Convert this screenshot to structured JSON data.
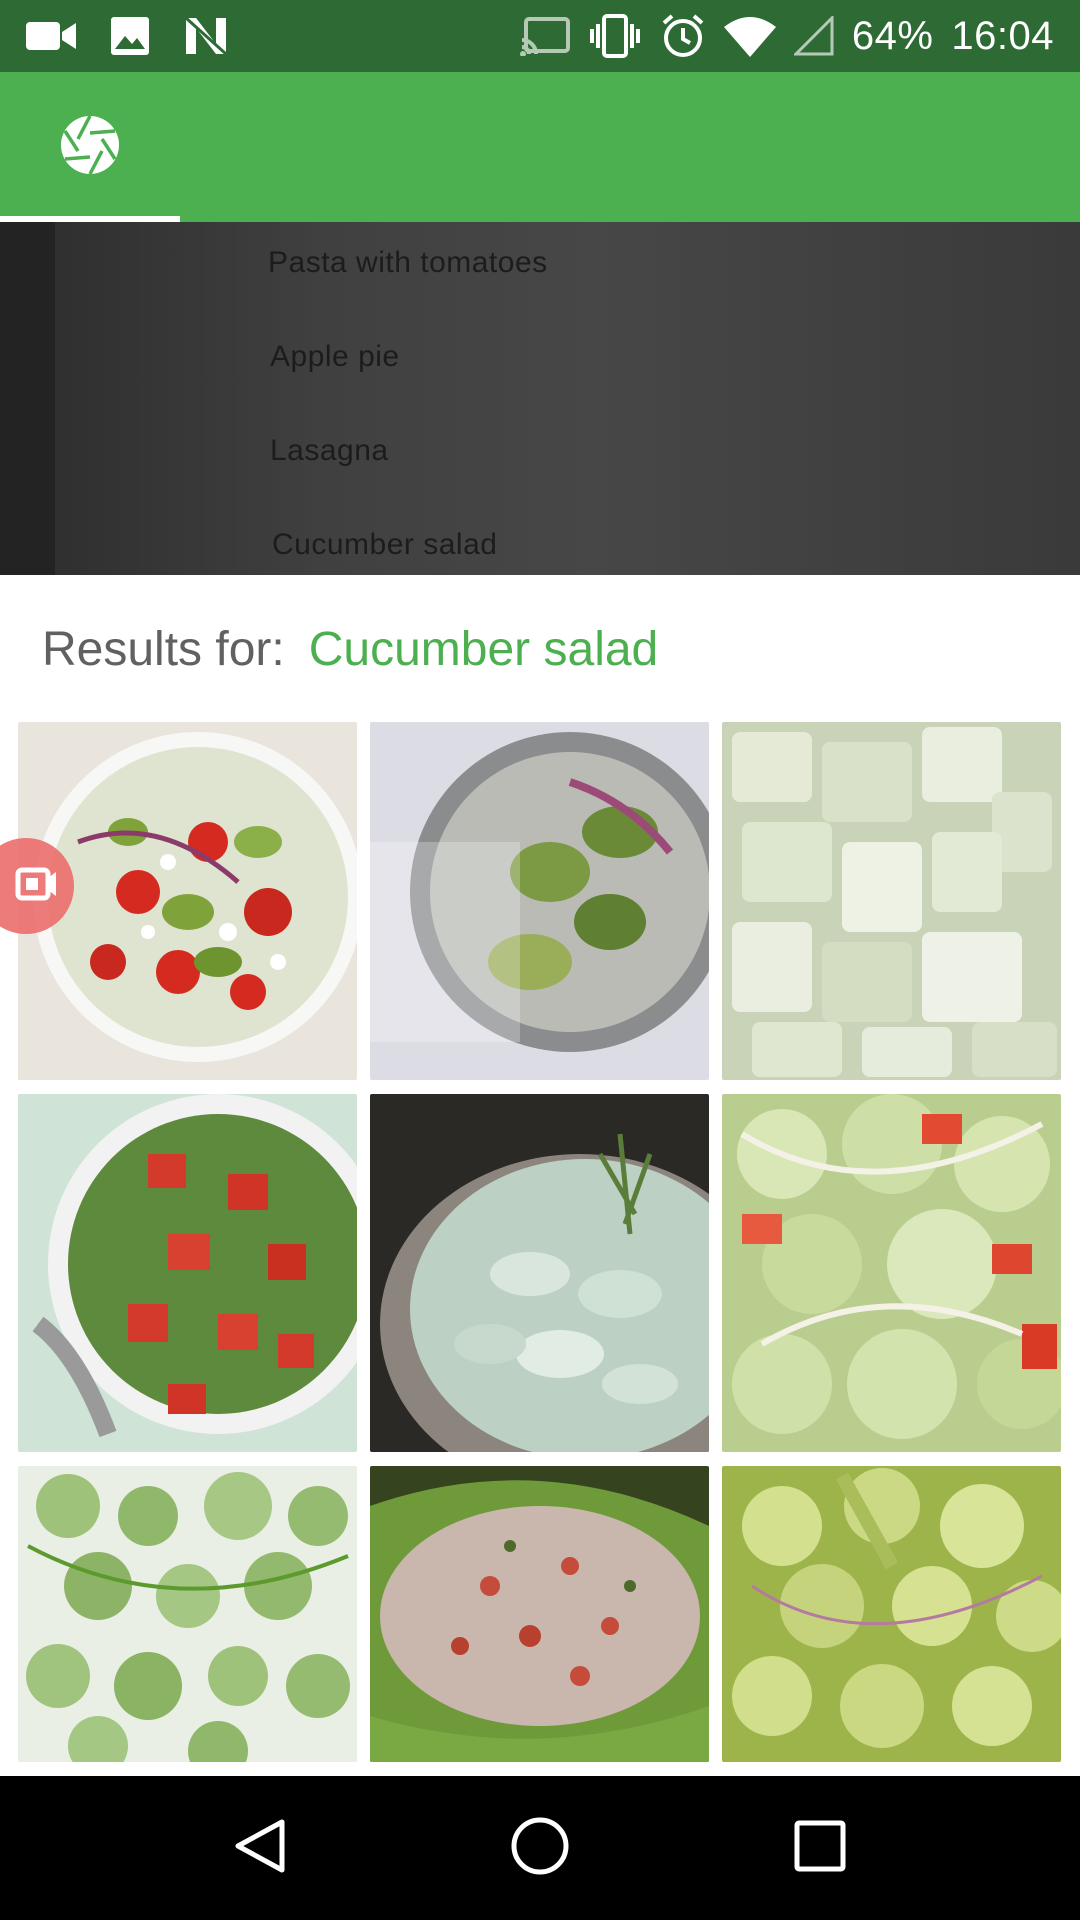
{
  "status_bar": {
    "battery": "64%",
    "time": "16:04",
    "left_icons": [
      "video-camera-icon",
      "image-icon",
      "n-logo-icon"
    ],
    "right_icons": [
      "cast-icon",
      "vibrate-icon",
      "alarm-icon",
      "wifi-icon",
      "signal-icon"
    ]
  },
  "app_bar": {
    "color": "#4caf50",
    "tab_icon": "camera-aperture-icon"
  },
  "camera_preview": {
    "lines": [
      "Pasta with tomatoes",
      "Apple pie",
      "Lasagna",
      "Cucumber salad"
    ]
  },
  "results": {
    "label": "Results for:",
    "query": "Cucumber salad",
    "accent": "#4caf50",
    "images": [
      {
        "name": "result-image-1",
        "icon": "salad-photo"
      },
      {
        "name": "result-image-2",
        "icon": "salad-photo"
      },
      {
        "name": "result-image-3",
        "icon": "salad-photo"
      },
      {
        "name": "result-image-4",
        "icon": "salad-photo"
      },
      {
        "name": "result-image-5",
        "icon": "salad-photo"
      },
      {
        "name": "result-image-6",
        "icon": "salad-photo"
      },
      {
        "name": "result-image-7",
        "icon": "salad-photo"
      },
      {
        "name": "result-image-8",
        "icon": "salad-photo"
      },
      {
        "name": "result-image-9",
        "icon": "salad-photo"
      }
    ]
  },
  "nav_bar": {
    "buttons": [
      "back-icon",
      "home-icon",
      "recents-icon"
    ]
  }
}
